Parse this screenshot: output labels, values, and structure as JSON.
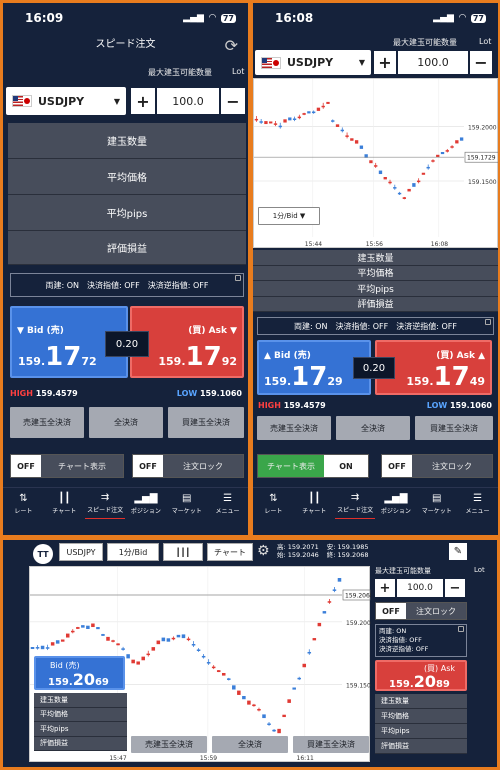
{
  "phone1": {
    "time": "16:09",
    "battery": "77",
    "title": "スピード注文",
    "lot_label": "最大建玉可能数量",
    "lot_unit": "Lot",
    "pair": "USDJPY",
    "qty": "100.0",
    "rows": [
      "建玉数量",
      "平均価格",
      "平均pips",
      "評価損益"
    ],
    "settings": "両建: ON　決済指値: OFF　決済逆指値: OFF",
    "bid": {
      "label": "▼ Bid (売)",
      "p1": "159.",
      "p2": "17",
      "p3": "72"
    },
    "ask": {
      "label": "(買) Ask ▼",
      "p1": "159.",
      "p2": "17",
      "p3": "92"
    },
    "spread": "0.20",
    "high_label": "HIGH",
    "high": "159.4579",
    "low_label": "LOW",
    "low": "159.1060",
    "btn_sell": "売建玉全決済",
    "btn_all": "全決済",
    "btn_buy": "買建玉全決済",
    "toggle_chart": "チャート表示",
    "toggle_lock": "注文ロック",
    "off": "OFF",
    "tabs": [
      "レート",
      "チャート",
      "スピード注文",
      "ポジション",
      "マーケット",
      "メニュー"
    ]
  },
  "phone2": {
    "time": "16:08",
    "battery": "77",
    "lot_label": "最大建玉可能数量",
    "lot_unit": "Lot",
    "pair": "USDJPY",
    "qty": "100.0",
    "timeframe": "1分/Bid ▼",
    "rows": [
      "建玉数量",
      "平均価格",
      "平均pips",
      "評価損益"
    ],
    "settings": "両建: ON　決済指値: OFF　決済逆指値: OFF",
    "bid": {
      "label": "▲ Bid (売)",
      "p1": "159.",
      "p2": "17",
      "p3": "29"
    },
    "ask": {
      "label": "(買) Ask ▲",
      "p1": "159.",
      "p2": "17",
      "p3": "49"
    },
    "spread": "0.20",
    "high_label": "HIGH",
    "high": "159.4579",
    "low_label": "LOW",
    "low": "159.1060",
    "btn_sell": "売建玉全決済",
    "btn_all": "全決済",
    "btn_buy": "買建玉全決済",
    "toggle_chart": "チャート表示",
    "on": "ON",
    "toggle_lock": "注文ロック",
    "off": "OFF",
    "tabs": [
      "レート",
      "チャート",
      "スピード注文",
      "ポジション",
      "マーケット",
      "メニュー"
    ]
  },
  "phone3": {
    "pair": "USDJPY",
    "timeframe": "1分/Bid",
    "chart_btn": "チャート",
    "ohlc": {
      "l1": "高: 159.2071",
      "l2": "安: 159.1985",
      "l3": "始: 159.2046",
      "l4": "終: 159.2068"
    },
    "lot_label": "最大建玉可能数量",
    "lot_unit": "Lot",
    "qty": "100.0",
    "off": "OFF",
    "toggle_lock": "注文ロック",
    "settings": {
      "l1": "両建: ON",
      "l2": "決済指値: OFF",
      "l3": "決済逆指値: OFF"
    },
    "bid": {
      "label": "Bid (売)",
      "p1": "159.",
      "p2": "20",
      "p3": "69"
    },
    "ask": {
      "label": "(買) Ask",
      "p1": "159.",
      "p2": "20",
      "p3": "89"
    },
    "rows": [
      "建玉数量",
      "平均価格",
      "平均pips",
      "評価損益"
    ],
    "btn_sell": "売建玉全決済",
    "btn_all": "全決済",
    "btn_buy": "買建玉全決済"
  },
  "chart_data": [
    {
      "type": "candlestick",
      "title": "",
      "y_ticks": [
        "159.2000",
        "159.1500"
      ],
      "current": "159.1729",
      "x_ticks": [
        "15:44",
        "15:56",
        "16:08"
      ]
    },
    {
      "type": "candlestick",
      "title": "",
      "y_ticks": [
        "159.2000",
        "159.1500"
      ],
      "current": "159.2068",
      "x_ticks": [
        "15:47",
        "15:59",
        "16:11"
      ]
    }
  ],
  "colors": {
    "bg": "#15223b",
    "bid": "#3572d4",
    "ask": "#d8403c",
    "up": "#e03a34",
    "down": "#3b7fd9"
  }
}
